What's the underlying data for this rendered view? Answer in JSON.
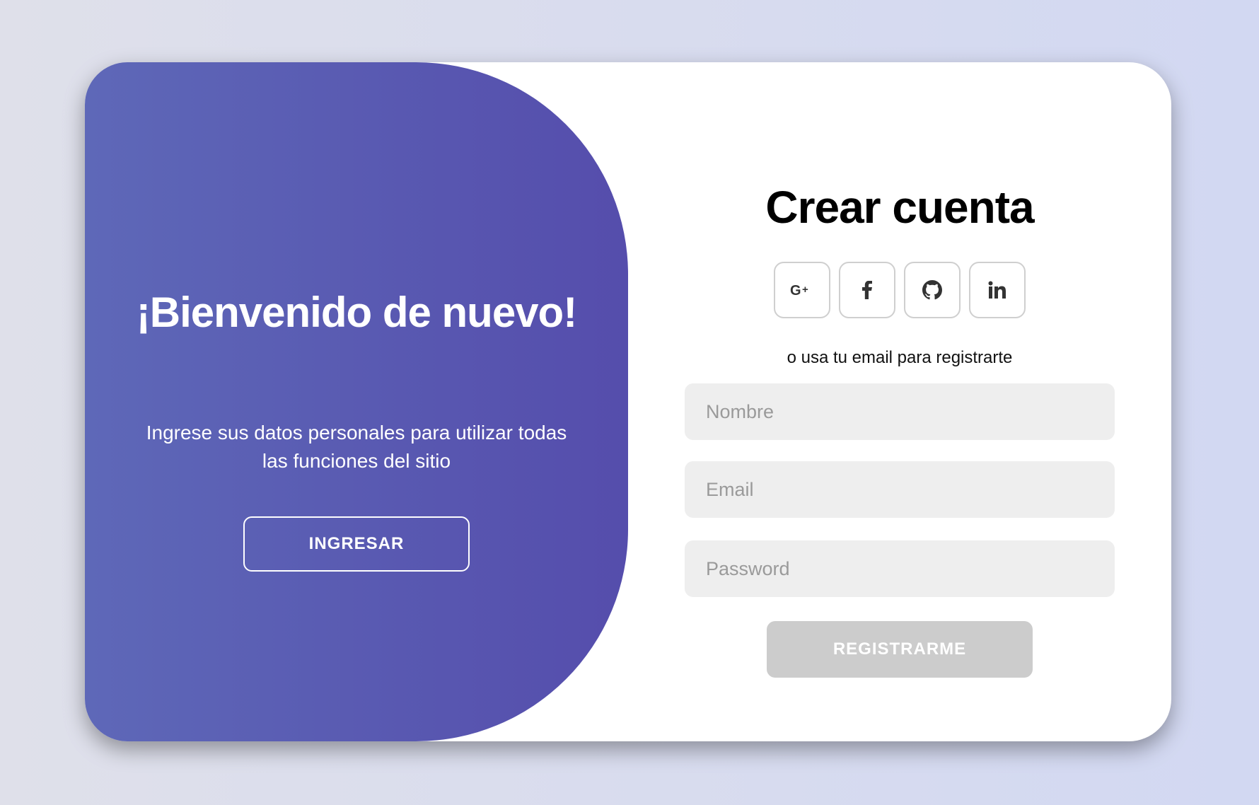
{
  "welcome": {
    "title": "¡Bienvenido de nuevo!",
    "text": "Ingrese sus datos personales para utilizar todas las funciones del sitio",
    "login_button": "INGRESAR"
  },
  "signup": {
    "title": "Crear cuenta",
    "socials": [
      {
        "name": "google-plus-icon",
        "glyph": "G+"
      },
      {
        "name": "facebook-icon",
        "glyph": "f"
      },
      {
        "name": "github-icon",
        "glyph": "github"
      },
      {
        "name": "linkedin-icon",
        "glyph": "in"
      }
    ],
    "subtitle": "o usa tu email para registrarte",
    "fields": {
      "name_placeholder": "Nombre",
      "email_placeholder": "Email",
      "password_placeholder": "Password"
    },
    "register_button": "REGISTRARME"
  },
  "colors": {
    "panel_start": "#5e68b8",
    "panel_end": "#554dac",
    "input_bg": "#eeeeee",
    "register_bg": "#cccccc"
  }
}
